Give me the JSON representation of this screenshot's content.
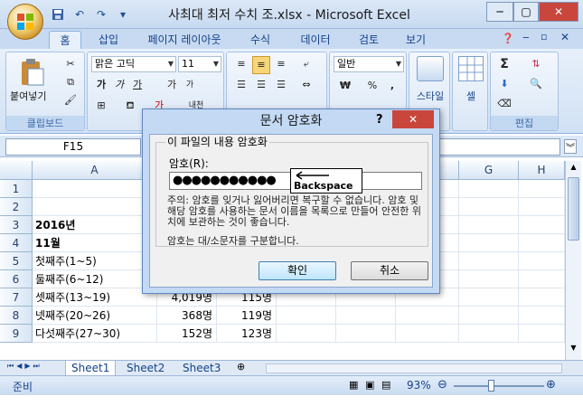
{
  "window": {
    "title": "사최대 최저 수치 조.xlsx - Microsoft Excel",
    "controls": [
      "─",
      "▢",
      "✕"
    ]
  },
  "qat": {
    "dropdown": "▾"
  },
  "tabs": [
    {
      "label": "홈",
      "active": true
    },
    {
      "label": "삽입"
    },
    {
      "label": "페이지 레이아웃"
    },
    {
      "label": "수식"
    },
    {
      "label": "데이터"
    },
    {
      "label": "검토"
    },
    {
      "label": "보기"
    }
  ],
  "ribbon": {
    "clipboard": {
      "paste": "붙여넣기",
      "label": "클립보드"
    },
    "font": {
      "name": "맑은 고딕",
      "size": "11",
      "bold": "가",
      "italic": "가",
      "underline": "가",
      "grow": "가",
      "shrink": "가",
      "color": "가",
      "phonetic": "내천"
    },
    "number": {
      "format": "일반",
      "currency": "₩",
      "percent": "%",
      "comma": ","
    },
    "styles": {
      "label": "스타일"
    },
    "cells": {
      "label": "셀"
    },
    "editing": {
      "sigma": "Σ",
      "label": "편집"
    }
  },
  "formula_bar": {
    "namebox": "F15"
  },
  "sheet": {
    "columns": [
      "A",
      "B",
      "C",
      "D",
      "E",
      "F",
      "G",
      "H"
    ],
    "rows": [
      {
        "num": "1",
        "a": "",
        "b": "",
        "c": ""
      },
      {
        "num": "2",
        "a": "",
        "b": "",
        "c": ""
      },
      {
        "num": "3",
        "a": "2016년",
        "b": "",
        "c": "",
        "bold": true
      },
      {
        "num": "4",
        "a": "11월",
        "b": "",
        "c": "",
        "bold": true
      },
      {
        "num": "5",
        "a": "첫째주(1~5)",
        "b": "",
        "c": ""
      },
      {
        "num": "6",
        "a": "둘째주(6~12)",
        "b": "",
        "c": ""
      },
      {
        "num": "7",
        "a": "셋째주(13~19)",
        "b": "4,019명",
        "c": "115명"
      },
      {
        "num": "8",
        "a": "넷째주(20~26)",
        "b": "368명",
        "c": "119명"
      },
      {
        "num": "9",
        "a": "다섯째주(27~30)",
        "b": "152명",
        "c": "123명"
      }
    ]
  },
  "sheet_tabs": [
    "Sheet1",
    "Sheet2",
    "Sheet3"
  ],
  "status": {
    "ready": "준비",
    "zoom": "93%"
  },
  "dialog": {
    "title": "문서 암호화",
    "help": "?",
    "group_label": "이 파일의 내용 암호화",
    "password_label": "암호(R):",
    "password_value": "●●●●●●●●●●●",
    "callout": "Backspace",
    "warning": "주의: 암호를 잊거나 잃어버리면 복구할 수 없습니다. 암호 및 해당 암호를 사용하는 문서 이름을 목록으로 만들어 안전한 위치에 보관하는 것이 좋습니다.",
    "case_note": "암호는 대/소문자를 구분합니다.",
    "ok": "확인",
    "cancel": "취소"
  }
}
